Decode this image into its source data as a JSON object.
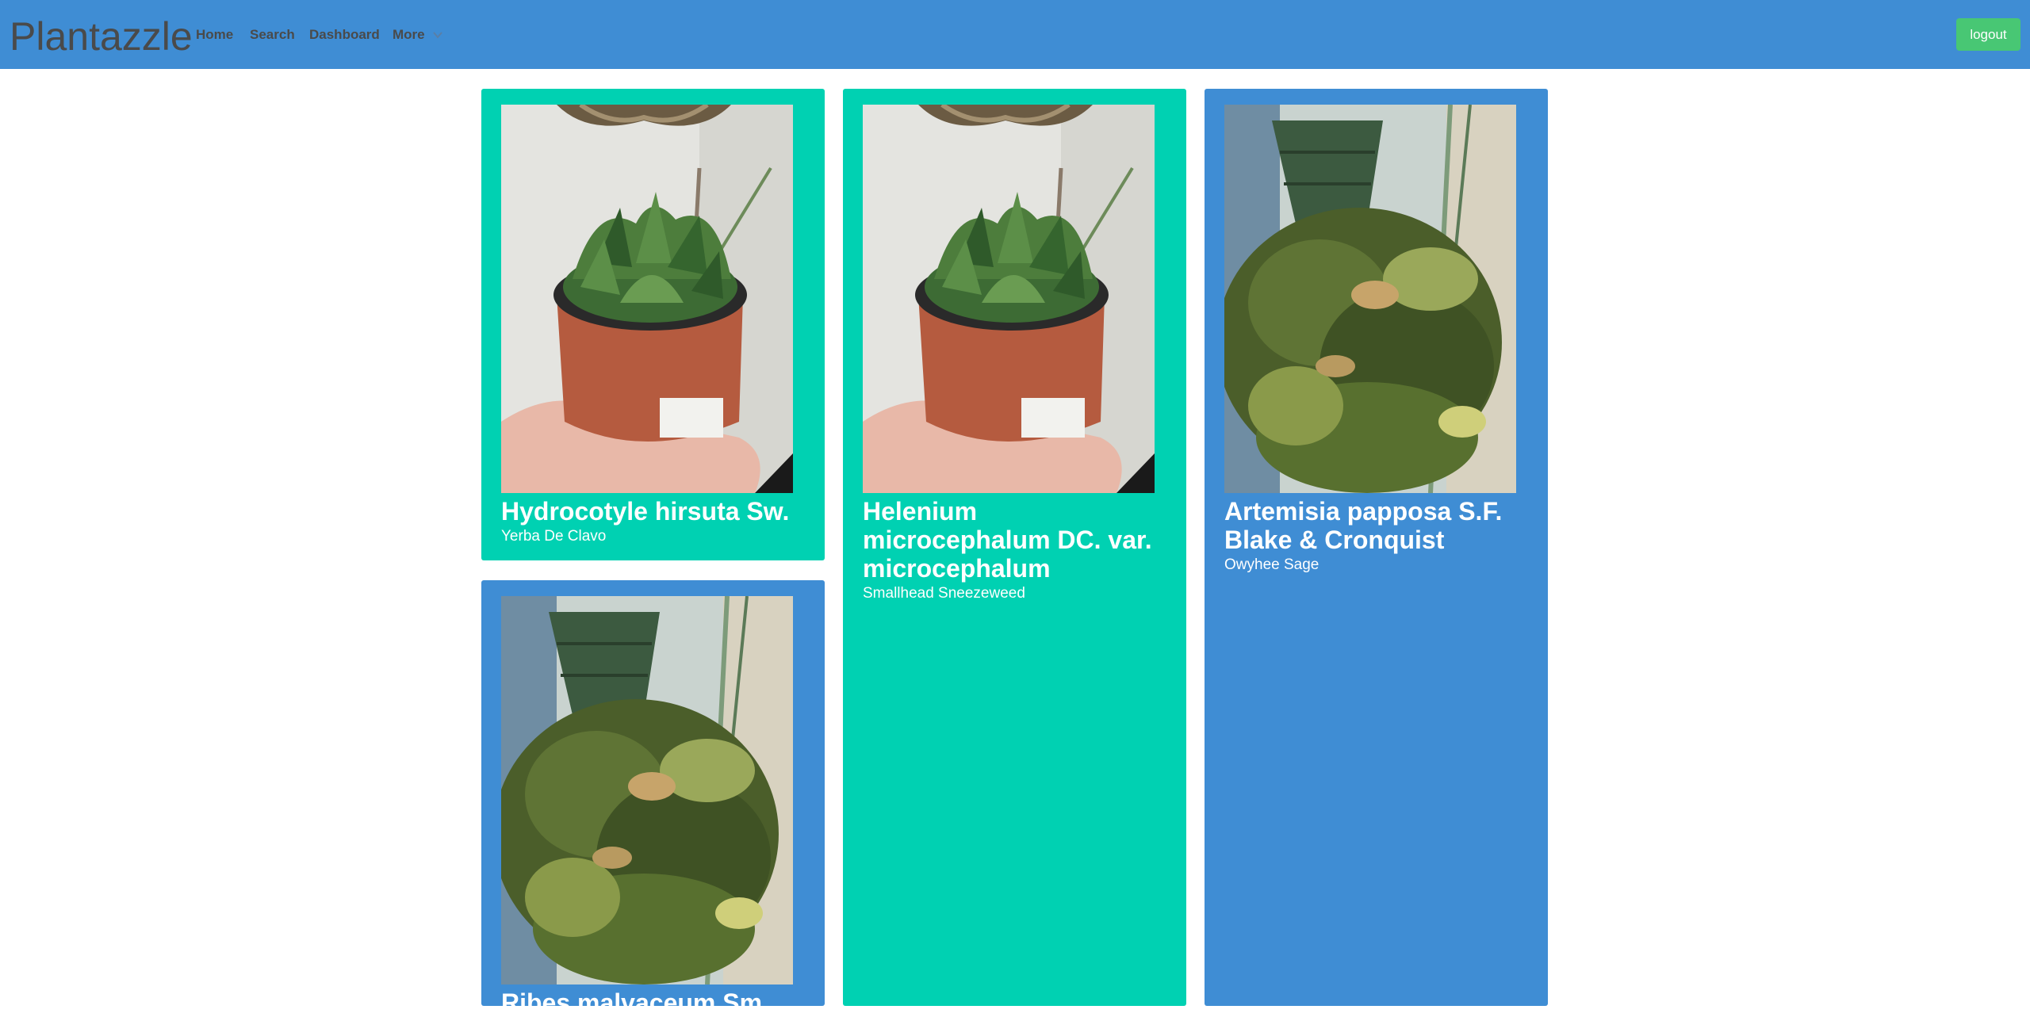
{
  "navbar": {
    "brand": "Plantazzle",
    "links": [
      "Home",
      "Search",
      "Dashboard",
      "More"
    ],
    "logout_label": "logout"
  },
  "cards": [
    {
      "title": "Hydrocotyle hirsuta Sw.",
      "common_name": "Yerba De Clavo",
      "image": "potted-succulent-photo",
      "color": "#00d1b2"
    },
    {
      "title": "Helenium microcephalum DC. var. microcephalum",
      "common_name": "Smallhead Sneezeweed",
      "image": "potted-succulent-photo",
      "color": "#00d1b2"
    },
    {
      "title": "Artemisia papposa S.F. Blake & Cronquist",
      "common_name": "Owyhee Sage",
      "image": "hanging-plant-photo",
      "color": "#3f8dd4"
    },
    {
      "title": "Ribes malvaceum Sm.",
      "common_name": "",
      "image": "hanging-plant-photo",
      "color": "#3f8dd4"
    }
  ]
}
